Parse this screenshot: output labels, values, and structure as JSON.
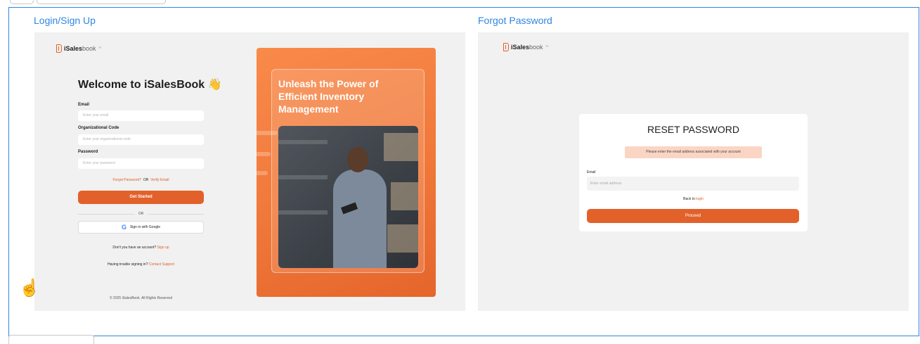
{
  "frames": [
    {
      "label": "Login/Sign Up"
    },
    {
      "label": "Forgot Password"
    }
  ],
  "brand": {
    "name_bold": "iSales",
    "name_light": "book",
    "trademark": "™",
    "accent": "#e2612a"
  },
  "login": {
    "heading": "Welcome to iSalesBook 👋",
    "email_label": "Email",
    "email_placeholder": "Enter your email",
    "org_label": "Organizational Code",
    "org_placeholder": "Enter your organizational code",
    "password_label": "Password",
    "password_placeholder": "Enter your password",
    "forgot_link": "Forgot Password?",
    "or_small": "OR",
    "verify_link": "Verify Email",
    "get_started": "Get Started",
    "divider_or": "OR",
    "google_label": "Sign in with Google",
    "google_icon": "google-g-icon",
    "no_account_text": "Don't you have an account?",
    "signup_link": "Sign up",
    "trouble_text": "Having trouble signing in?",
    "support_link": "Contact Support",
    "copyright": "© 2025 iSalesBook. All Rights Reserved",
    "promo_headline": "Unleash the Power of Efficient Inventory Management"
  },
  "reset": {
    "title": "RESET PASSWORD",
    "notice": "Please enter the email address associated with your account",
    "email_label": "Email",
    "email_placeholder": "Enter email address",
    "back_text": "Back to",
    "login_link": "login",
    "proceed": "Proceed"
  },
  "cursor": "hand-cursor-icon"
}
